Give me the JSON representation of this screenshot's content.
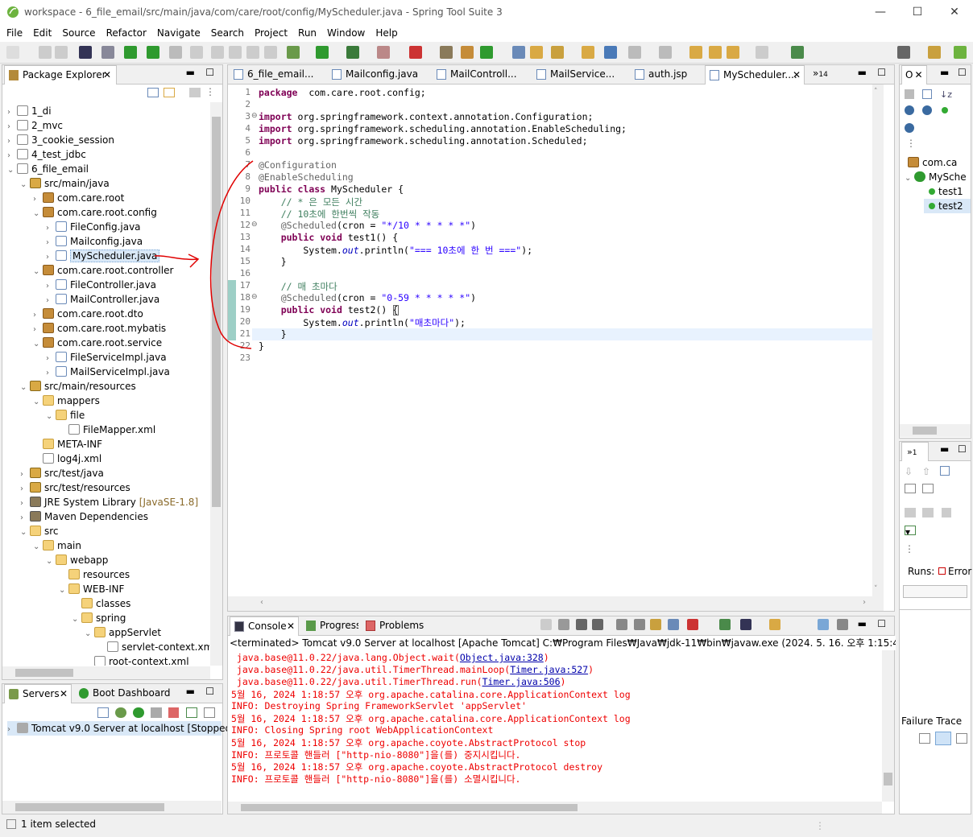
{
  "window": {
    "title": "workspace - 6_file_email/src/main/java/com/care/root/config/MyScheduler.java - Spring Tool Suite 3"
  },
  "menu": [
    "File",
    "Edit",
    "Source",
    "Refactor",
    "Navigate",
    "Search",
    "Project",
    "Run",
    "Window",
    "Help"
  ],
  "package_explorer": {
    "tab_label": "Package Explorer",
    "items": [
      {
        "label": "1_di",
        "depth": 0,
        "arrow": "›",
        "icon": "proj"
      },
      {
        "label": "2_mvc",
        "depth": 0,
        "arrow": "›",
        "icon": "proj"
      },
      {
        "label": "3_cookie_session",
        "depth": 0,
        "arrow": "›",
        "icon": "proj"
      },
      {
        "label": "4_test_jdbc",
        "depth": 0,
        "arrow": "›",
        "icon": "proj"
      },
      {
        "label": "6_file_email",
        "depth": 0,
        "arrow": "⌄",
        "icon": "proj"
      },
      {
        "label": "src/main/java",
        "depth": 1,
        "arrow": "⌄",
        "icon": "src"
      },
      {
        "label": "com.care.root",
        "depth": 2,
        "arrow": "›",
        "icon": "pkg"
      },
      {
        "label": "com.care.root.config",
        "depth": 2,
        "arrow": "⌄",
        "icon": "pkg"
      },
      {
        "label": "FileConfig.java",
        "depth": 3,
        "arrow": "›",
        "icon": "java"
      },
      {
        "label": "Mailconfig.java",
        "depth": 3,
        "arrow": "›",
        "icon": "java"
      },
      {
        "label": "MyScheduler.java",
        "depth": 3,
        "arrow": "›",
        "icon": "java",
        "selected": true
      },
      {
        "label": "com.care.root.controller",
        "depth": 2,
        "arrow": "⌄",
        "icon": "pkg"
      },
      {
        "label": "FileController.java",
        "depth": 3,
        "arrow": "›",
        "icon": "java"
      },
      {
        "label": "MailController.java",
        "depth": 3,
        "arrow": "›",
        "icon": "java"
      },
      {
        "label": "com.care.root.dto",
        "depth": 2,
        "arrow": "›",
        "icon": "pkg"
      },
      {
        "label": "com.care.root.mybatis",
        "depth": 2,
        "arrow": "›",
        "icon": "pkg"
      },
      {
        "label": "com.care.root.service",
        "depth": 2,
        "arrow": "⌄",
        "icon": "pkg"
      },
      {
        "label": "FileServiceImpl.java",
        "depth": 3,
        "arrow": "›",
        "icon": "java"
      },
      {
        "label": "MailServiceImpl.java",
        "depth": 3,
        "arrow": "›",
        "icon": "java"
      },
      {
        "label": "src/main/resources",
        "depth": 1,
        "arrow": "⌄",
        "icon": "src"
      },
      {
        "label": "mappers",
        "depth": 2,
        "arrow": "⌄",
        "icon": "folder"
      },
      {
        "label": "file",
        "depth": 3,
        "arrow": "⌄",
        "icon": "folder"
      },
      {
        "label": "FileMapper.xml",
        "depth": 4,
        "arrow": "",
        "icon": "xml"
      },
      {
        "label": "META-INF",
        "depth": 2,
        "arrow": "",
        "icon": "folder"
      },
      {
        "label": "log4j.xml",
        "depth": 2,
        "arrow": "",
        "icon": "xml"
      },
      {
        "label": "src/test/java",
        "depth": 1,
        "arrow": "›",
        "icon": "src"
      },
      {
        "label": "src/test/resources",
        "depth": 1,
        "arrow": "›",
        "icon": "src"
      },
      {
        "label": "JRE System Library",
        "suffix": "[JavaSE-1.8]",
        "depth": 1,
        "arrow": "›",
        "icon": "jar"
      },
      {
        "label": "Maven Dependencies",
        "depth": 1,
        "arrow": "›",
        "icon": "jar"
      },
      {
        "label": "src",
        "depth": 1,
        "arrow": "⌄",
        "icon": "folder"
      },
      {
        "label": "main",
        "depth": 2,
        "arrow": "⌄",
        "icon": "folder"
      },
      {
        "label": "webapp",
        "depth": 3,
        "arrow": "⌄",
        "icon": "folder"
      },
      {
        "label": "resources",
        "depth": 4,
        "arrow": "",
        "icon": "folder"
      },
      {
        "label": "WEB-INF",
        "depth": 4,
        "arrow": "⌄",
        "icon": "folder"
      },
      {
        "label": "classes",
        "depth": 5,
        "arrow": "",
        "icon": "folder"
      },
      {
        "label": "spring",
        "depth": 5,
        "arrow": "⌄",
        "icon": "folder"
      },
      {
        "label": "appServlet",
        "depth": 6,
        "arrow": "⌄",
        "icon": "folder"
      },
      {
        "label": "servlet-context.xml",
        "depth": 7,
        "arrow": "",
        "icon": "xml"
      },
      {
        "label": "root-context.xml",
        "depth": 6,
        "arrow": "",
        "icon": "xml"
      }
    ]
  },
  "servers": {
    "tabs": [
      "Servers",
      "Boot Dashboard"
    ],
    "items": [
      "Tomcat v9.0 Server at localhost  [Stopped,"
    ]
  },
  "editor": {
    "tabs": [
      "6_file_email...",
      "Mailconfig.java",
      "MailControll...",
      "MailService...",
      "auth.jsp",
      "MyScheduler...."
    ],
    "overflow_count": "14",
    "lines": [
      {
        "n": "1",
        "c": [
          [
            "kw",
            "package"
          ],
          [
            "",
            "  com.care.root.config;"
          ]
        ]
      },
      {
        "n": "2",
        "c": []
      },
      {
        "n": "3",
        "c": [
          [
            "kw",
            "import"
          ],
          [
            "",
            " org.springframework.context.annotation.Configuration;"
          ]
        ],
        "fold": true
      },
      {
        "n": "4",
        "c": [
          [
            "kw",
            "import"
          ],
          [
            "",
            " org.springframework.scheduling.annotation.EnableScheduling;"
          ]
        ]
      },
      {
        "n": "5",
        "c": [
          [
            "kw",
            "import"
          ],
          [
            "",
            " org.springframework.scheduling.annotation.Scheduled;"
          ]
        ]
      },
      {
        "n": "6",
        "c": []
      },
      {
        "n": "7",
        "c": [
          [
            "ann",
            "@Configuration"
          ]
        ]
      },
      {
        "n": "8",
        "c": [
          [
            "ann",
            "@EnableScheduling"
          ]
        ]
      },
      {
        "n": "9",
        "c": [
          [
            "kw",
            "public"
          ],
          [
            "",
            " "
          ],
          [
            "kw",
            "class"
          ],
          [
            "",
            " MyScheduler {"
          ]
        ]
      },
      {
        "n": "10",
        "c": [
          [
            "",
            "    "
          ],
          [
            "cm",
            "// * 은 모든 시간"
          ]
        ]
      },
      {
        "n": "11",
        "c": [
          [
            "",
            "    "
          ],
          [
            "cm",
            "// 10초에 한번씩 작동"
          ]
        ]
      },
      {
        "n": "12",
        "c": [
          [
            "",
            "    "
          ],
          [
            "ann",
            "@Scheduled"
          ],
          [
            "",
            "(cron = "
          ],
          [
            "st",
            "\"*/10 * * * * *\""
          ],
          [
            "",
            ")"
          ]
        ],
        "fold": true
      },
      {
        "n": "13",
        "c": [
          [
            "",
            "    "
          ],
          [
            "kw",
            "public"
          ],
          [
            "",
            " "
          ],
          [
            "kw",
            "void"
          ],
          [
            "",
            " test1() {"
          ]
        ]
      },
      {
        "n": "14",
        "c": [
          [
            "",
            "        System."
          ],
          [
            "fld",
            "out"
          ],
          [
            "",
            ".println("
          ],
          [
            "st",
            "\"=== 10초에 한 번 ===\""
          ],
          [
            "",
            ");"
          ]
        ]
      },
      {
        "n": "15",
        "c": [
          [
            "",
            "    }"
          ]
        ]
      },
      {
        "n": "16",
        "c": []
      },
      {
        "n": "17",
        "c": [
          [
            "",
            "    "
          ],
          [
            "cm",
            "// 매 초마다"
          ]
        ]
      },
      {
        "n": "18",
        "c": [
          [
            "",
            "    "
          ],
          [
            "ann",
            "@Scheduled"
          ],
          [
            "",
            "(cron = "
          ],
          [
            "st",
            "\"0-59 * * * * *\""
          ],
          [
            "",
            ")"
          ]
        ],
        "fold": true
      },
      {
        "n": "19",
        "c": [
          [
            "",
            "    "
          ],
          [
            "kw",
            "public"
          ],
          [
            "",
            " "
          ],
          [
            "kw",
            "void"
          ],
          [
            "",
            " test2() {"
          ]
        ]
      },
      {
        "n": "20",
        "c": [
          [
            "",
            "        System."
          ],
          [
            "fld",
            "out"
          ],
          [
            "",
            ".println("
          ],
          [
            "st",
            "\"매초마다\""
          ],
          [
            "",
            ");"
          ]
        ]
      },
      {
        "n": "21",
        "c": [
          [
            "",
            "    }"
          ]
        ],
        "highlight": true
      },
      {
        "n": "22",
        "c": [
          [
            "",
            "}"
          ]
        ]
      },
      {
        "n": "23",
        "c": []
      }
    ]
  },
  "console": {
    "tabs": [
      "Console",
      "Progress",
      "Problems"
    ],
    "header": "<terminated> Tomcat v9.0 Server at localhost [Apache Tomcat] C:₩Program Files₩Java₩jdk-11₩bin₩javaw.exe  (2024. 5. 16. 오후 1:15:46 – 오후 1:18:5",
    "lines": [
      {
        "t": " java.base@11.0.22/java.lang.Object.wait(",
        "link": "Object.java:328",
        "end": ")"
      },
      {
        "t": " java.base@11.0.22/java.util.TimerThread.mainLoop(",
        "link": "Timer.java:527",
        "end": ")"
      },
      {
        "t": " java.base@11.0.22/java.util.TimerThread.run(",
        "link": "Timer.java:506",
        "end": ")"
      },
      {
        "t": "5월 16, 2024 1:18:57 오후 org.apache.catalina.core.ApplicationContext log"
      },
      {
        "t": "INFO: Destroying Spring FrameworkServlet 'appServlet'"
      },
      {
        "t": "5월 16, 2024 1:18:57 오후 org.apache.catalina.core.ApplicationContext log"
      },
      {
        "t": "INFO: Closing Spring root WebApplicationContext"
      },
      {
        "t": "5월 16, 2024 1:18:57 오후 org.apache.coyote.AbstractProtocol stop"
      },
      {
        "t": "INFO: 프로토콜 핸들러 [\"http-nio-8080\"]을(를) 중지시킵니다."
      },
      {
        "t": "5월 16, 2024 1:18:57 오후 org.apache.coyote.AbstractProtocol destroy"
      },
      {
        "t": "INFO: 프로토콜 핸들러 [\"http-nio-8080\"]을(를) 소멸시킵니다."
      }
    ]
  },
  "outline": {
    "tab_label": "O",
    "items": [
      "com.ca",
      "MySche",
      "test1",
      "test2"
    ]
  },
  "junit": {
    "tab_count": "1",
    "runs_label": "Runs:",
    "errors_label": "Error",
    "failure_trace": "Failure Trace"
  },
  "status": {
    "text": "1 item selected"
  },
  "colors": {
    "accent": "#4a6a9c",
    "annotation_red": "#e00000"
  }
}
